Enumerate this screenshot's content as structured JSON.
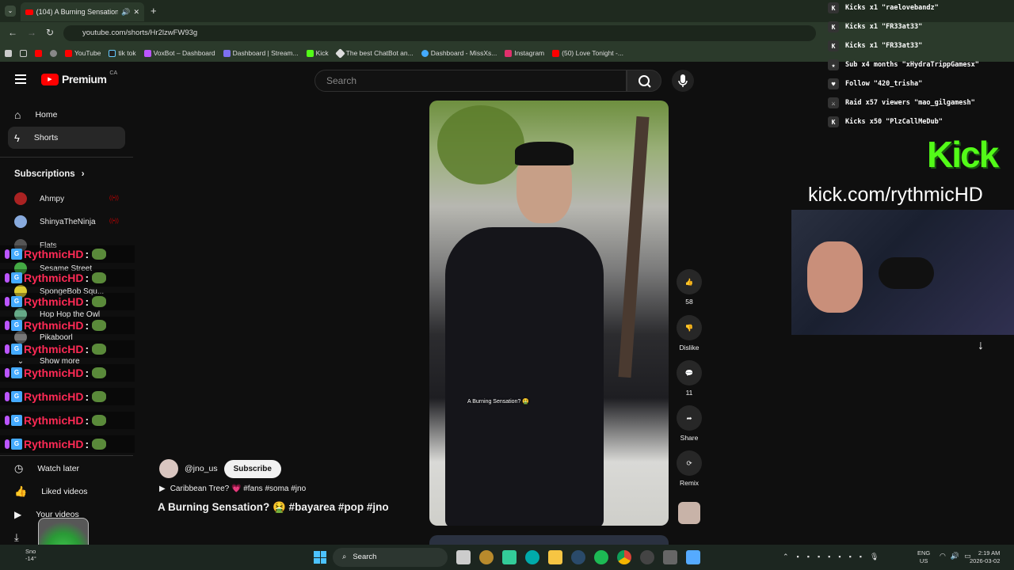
{
  "browser": {
    "tab_title": "(104) A Burning Sensation?",
    "url": "youtube.com/shorts/Hr2lzwFW93g",
    "bookmarks": [
      "YouTube",
      "tik tok",
      "VoxBot – Dashboard",
      "Dashboard | Stream...",
      "Kick",
      "The best ChatBot an...",
      "Dashboard - MissXs...",
      "Instagram",
      "(50) Love Tonight -..."
    ]
  },
  "youtube": {
    "brand": "Premium",
    "region": "CA",
    "search_placeholder": "Search",
    "nav": {
      "home": "Home",
      "shorts": "Shorts"
    },
    "subscriptions_label": "Subscriptions",
    "subscriptions": [
      {
        "name": "Ahmpy",
        "live": "((•))"
      },
      {
        "name": "ShinyaTheNinja",
        "live": "((•))"
      },
      {
        "name": "Flats",
        "live": "((•))"
      },
      {
        "name": "Sesame Street",
        "live": "((•))"
      },
      {
        "name": "SpongeBob Squ...",
        "live": "((•))"
      },
      {
        "name": "Hop Hop the Owl",
        "live": "((•))"
      },
      {
        "name": "Pikaboorl",
        "live": ""
      }
    ],
    "show_more": "Show more",
    "library": {
      "watch_later": "Watch later",
      "liked": "Liked videos",
      "your_videos": "Your videos"
    },
    "short": {
      "channel": "@jno_us",
      "subscribe": "Subscribe",
      "song": "Caribbean Tree? 💗 #fans #soma #jno",
      "title": "A Burning Sensation? 🤮 #bayarea #pop #jno",
      "caption": "A Burning Sensation? 🤮",
      "likes": "58",
      "dislike": "Dislike",
      "comments": "11",
      "share": "Share",
      "remix": "Remix"
    }
  },
  "overlay": {
    "chat_name": "RythmicHD",
    "chat_suffix": ":",
    "chat_lines": 9,
    "events": [
      {
        "icon": "kick-icon",
        "text": "Kicks x1 \"raelovebandz\""
      },
      {
        "icon": "kick-icon",
        "text": "Kicks x1 \"FR33at33\""
      },
      {
        "icon": "kick-icon",
        "text": "Kicks x1 \"FR33at33\""
      },
      {
        "icon": "star-icon",
        "text": "Sub x4 months \"xHydraTrippGamesx\""
      },
      {
        "icon": "heart-icon",
        "text": "Follow \"420_trisha\""
      },
      {
        "icon": "raid-icon",
        "text": "Raid x57 viewers \"mao_gilgamesh\""
      },
      {
        "icon": "kick-icon",
        "text": "Kicks x50 \"PlzCallMeDub\""
      }
    ],
    "kick_logo": "Kick",
    "kick_url": "kick.com/rythmicHD"
  },
  "taskbar": {
    "search": "Search",
    "weather_short": "Sno",
    "temp": "-14°",
    "lang": "ENG",
    "lang_region": "US",
    "time": "2:19 AM",
    "date": "2026-03-02"
  }
}
